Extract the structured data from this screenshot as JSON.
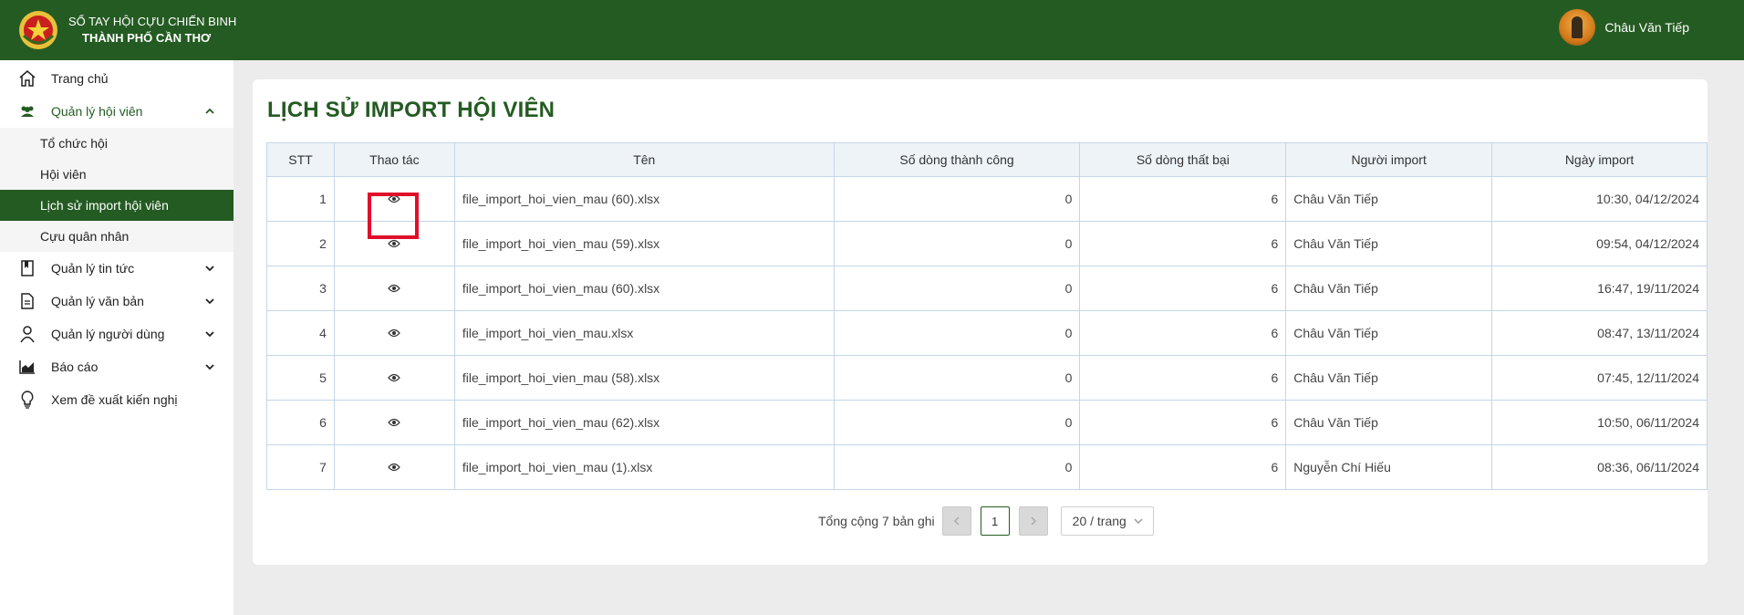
{
  "header": {
    "brand_line1": "SỔ TAY HỘI CỰU CHIẾN BINH",
    "brand_line2": "THÀNH PHỐ CẦN THƠ",
    "user_name": "Châu Văn Tiếp"
  },
  "sidebar": {
    "items": [
      {
        "label": "Trang chủ",
        "icon": "home-icon"
      },
      {
        "label": "Quản lý hội viên",
        "icon": "users-icon",
        "open": true,
        "children": [
          {
            "label": "Tổ chức hội"
          },
          {
            "label": "Hội viên"
          },
          {
            "label": "Lịch sử import hội viên",
            "active": true
          },
          {
            "label": "Cựu quân nhân"
          }
        ]
      },
      {
        "label": "Quản lý tin tức",
        "icon": "book-icon"
      },
      {
        "label": "Quản lý văn bản",
        "icon": "document-icon"
      },
      {
        "label": "Quản lý người dùng",
        "icon": "user-icon"
      },
      {
        "label": "Báo cáo",
        "icon": "chart-icon"
      },
      {
        "label": "Xem đề xuất kiến nghị",
        "icon": "lightbulb-icon"
      }
    ]
  },
  "main": {
    "title": "LỊCH SỬ IMPORT HỘI VIÊN",
    "columns": [
      "STT",
      "Thao tác",
      "Tên",
      "Số dòng thành công",
      "Số dòng thất bại",
      "Người import",
      "Ngày import"
    ],
    "rows": [
      {
        "stt": "1",
        "name": "file_import_hoi_vien_mau (60).xlsx",
        "success": "0",
        "failed": "6",
        "importer": "Châu Văn Tiếp",
        "date": "10:30, 04/12/2024"
      },
      {
        "stt": "2",
        "name": "file_import_hoi_vien_mau (59).xlsx",
        "success": "0",
        "failed": "6",
        "importer": "Châu Văn Tiếp",
        "date": "09:54, 04/12/2024"
      },
      {
        "stt": "3",
        "name": "file_import_hoi_vien_mau (60).xlsx",
        "success": "0",
        "failed": "6",
        "importer": "Châu Văn Tiếp",
        "date": "16:47, 19/11/2024"
      },
      {
        "stt": "4",
        "name": "file_import_hoi_vien_mau.xlsx",
        "success": "0",
        "failed": "6",
        "importer": "Châu Văn Tiếp",
        "date": "08:47, 13/11/2024"
      },
      {
        "stt": "5",
        "name": "file_import_hoi_vien_mau (58).xlsx",
        "success": "0",
        "failed": "6",
        "importer": "Châu Văn Tiếp",
        "date": "07:45, 12/11/2024"
      },
      {
        "stt": "6",
        "name": "file_import_hoi_vien_mau (62).xlsx",
        "success": "0",
        "failed": "6",
        "importer": "Châu Văn Tiếp",
        "date": "10:50, 06/11/2024"
      },
      {
        "stt": "7",
        "name": "file_import_hoi_vien_mau (1).xlsx",
        "success": "0",
        "failed": "6",
        "importer": "Nguyễn Chí Hiếu",
        "date": "08:36, 06/11/2024"
      }
    ],
    "pagination": {
      "total_text": "Tổng cộng 7 bản ghi",
      "current_page": "1",
      "page_size": "20 / trang"
    }
  },
  "colors": {
    "primary": "#245b22",
    "highlight": "#e0102a",
    "table_border": "#c3d6e8"
  }
}
